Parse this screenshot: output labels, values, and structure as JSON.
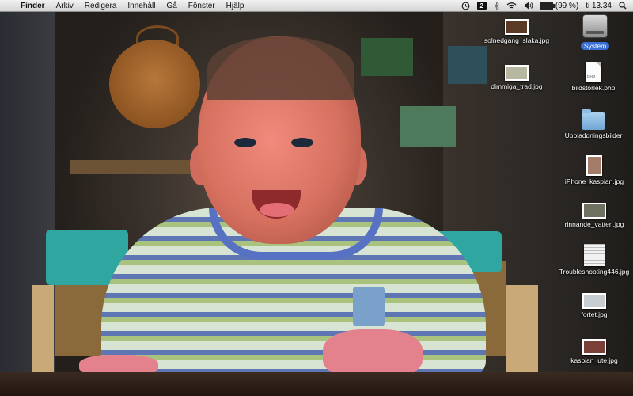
{
  "menubar": {
    "apple_glyph": "",
    "items": [
      "Finder",
      "Arkiv",
      "Redigera",
      "Innehåll",
      "Gå",
      "Fönster",
      "Hjälp"
    ],
    "status_icons": [
      "timemachine-icon",
      "spaces-icon",
      "bluetooth-icon",
      "wifi-icon",
      "volume-icon",
      "battery-icon"
    ],
    "battery_text": "(99 %)",
    "battery_level": 0.99,
    "clock": "ti 13.34",
    "search_icon": "spotlight-icon"
  },
  "desktop": {
    "icons": [
      {
        "label": "System",
        "kind": "hard-drive",
        "selected": true
      },
      {
        "label": "solnedgang_slaka.jpg",
        "kind": "photo",
        "color": "#5a3a24"
      },
      {
        "label": "dimmiga_trad.jpg",
        "kind": "photo",
        "color": "#b8b7a0"
      },
      {
        "label": "bildstorlek.php",
        "kind": "php-doc",
        "badge": "PHP"
      },
      {
        "label": "Uppladdningsbilder",
        "kind": "folder"
      },
      {
        "label": "iPhone_kaspian.jpg",
        "kind": "photo",
        "color": "#a47c6a"
      },
      {
        "label": "rinnande_vatten.jpg",
        "kind": "photo",
        "color": "#6e7060"
      },
      {
        "label": "Troubleshooting446.jpg",
        "kind": "document-image"
      },
      {
        "label": "fortet.jpg",
        "kind": "photo",
        "color": "#c8cdd2"
      },
      {
        "label": "kaspian_ute.jpg",
        "kind": "photo",
        "color": "#7a4038"
      }
    ]
  },
  "colors": {
    "menubar_bg": "#e6e6e6",
    "selection": "#3a6fd8",
    "label_text": "#ffffff"
  }
}
